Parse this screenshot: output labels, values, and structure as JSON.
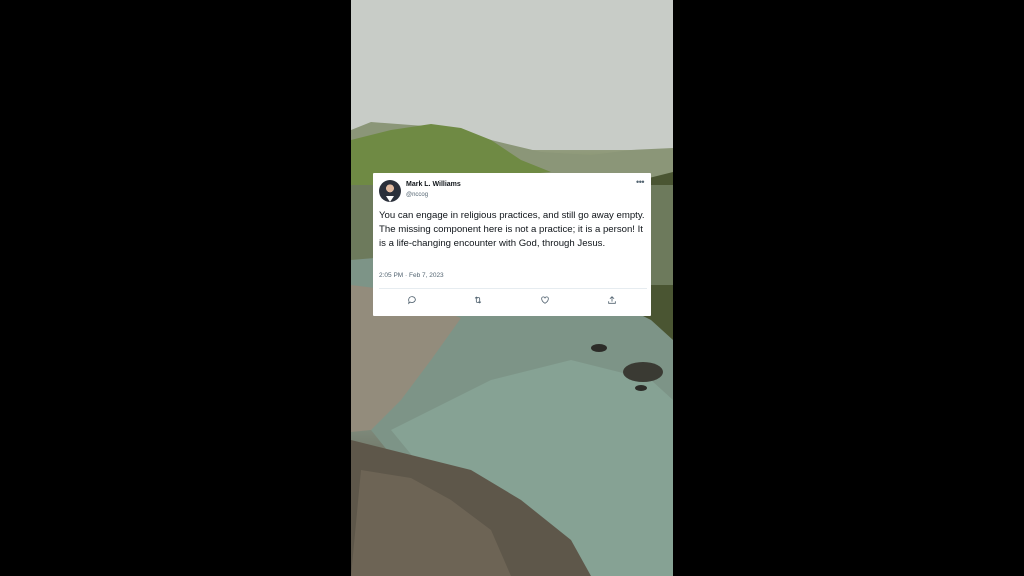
{
  "tweet": {
    "author_name": "Mark L. Williams",
    "author_handle": "@nccog",
    "text": "You can engage in religious practices, and still go away empty. The missing component here is not a practice; it is a person! It is a life-changing encounter with God, through Jesus.",
    "timestamp": "2:05 PM · Feb 7, 2023",
    "more_icon": "more-horizontal-icon",
    "actions": [
      "reply-icon",
      "retweet-icon",
      "like-icon",
      "share-icon"
    ]
  },
  "colors": {
    "card_background": "#ffffff",
    "text_primary": "#0f1419",
    "text_secondary": "#536471",
    "letterbox": "#000000"
  }
}
